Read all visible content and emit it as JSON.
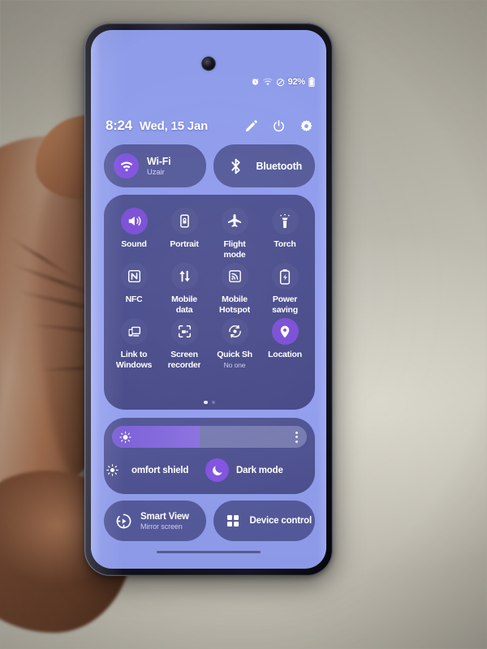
{
  "status_bar": {
    "icons": [
      "alarm-icon",
      "wifi-icon",
      "dnd-icon"
    ],
    "battery_percent": "92%",
    "battery_icon": "battery-icon"
  },
  "header": {
    "time": "8:24",
    "date": "Wed, 15 Jan",
    "actions": [
      {
        "name": "edit-button",
        "icon": "pencil-icon"
      },
      {
        "name": "power-button",
        "icon": "power-icon"
      },
      {
        "name": "settings-button",
        "icon": "gear-icon"
      }
    ]
  },
  "connectivity": [
    {
      "title": "Wi-Fi",
      "subtitle": "Uzair",
      "icon": "wifi-icon",
      "state": "on"
    },
    {
      "title": "Bluetooth",
      "subtitle": "",
      "icon": "bluetooth-icon",
      "state": "off"
    }
  ],
  "tiles": [
    {
      "label": "Sound",
      "sub": "",
      "icon": "speaker-icon",
      "state": "on"
    },
    {
      "label": "Portrait",
      "sub": "",
      "icon": "rotation-lock-icon",
      "state": "off"
    },
    {
      "label": "Flight\nmode",
      "sub": "",
      "icon": "airplane-icon",
      "state": "off"
    },
    {
      "label": "Torch",
      "sub": "",
      "icon": "flashlight-icon",
      "state": "off"
    },
    {
      "label": "NFC",
      "sub": "",
      "icon": "nfc-icon",
      "state": "off"
    },
    {
      "label": "Mobile\ndata",
      "sub": "",
      "icon": "data-arrows-icon",
      "state": "off"
    },
    {
      "label": "Mobile\nHotspot",
      "sub": "",
      "icon": "hotspot-icon",
      "state": "off"
    },
    {
      "label": "Power\nsaving",
      "sub": "",
      "icon": "battery-saver-icon",
      "state": "off"
    },
    {
      "label": "Link to\nWindows",
      "sub": "",
      "icon": "link-windows-icon",
      "state": "off"
    },
    {
      "label": "Screen\nrecorder",
      "sub": "",
      "icon": "screen-record-icon",
      "state": "off"
    },
    {
      "label": "Quick Sh",
      "sub": "No one",
      "icon": "quick-share-icon",
      "state": "off"
    },
    {
      "label": "Location",
      "sub": "",
      "icon": "location-pin-icon",
      "state": "on"
    }
  ],
  "pagination": {
    "total": 2,
    "active": 1
  },
  "brightness": {
    "value_percent": 45,
    "sun_icon": "brightness-sun-icon",
    "menu_icon": "kebab-menu-icon"
  },
  "brightness_toggles": [
    {
      "label": "omfort shield",
      "icon": "eye-comfort-icon",
      "state": "off"
    },
    {
      "label": "Dark mode",
      "icon": "moon-icon",
      "state": "on"
    }
  ],
  "bottom_tiles": [
    {
      "title": "Smart View",
      "subtitle": "Mirror screen",
      "icon": "cast-play-icon"
    },
    {
      "title": "Device control",
      "subtitle": "",
      "icon": "grid-squares-icon"
    }
  ],
  "colors": {
    "screen_bg": "#909dee",
    "panel": "#3e3f7a",
    "accent_purple": "#7b4fd6",
    "accent_purple_light": "#8253e0",
    "text_primary": "#ffffff",
    "text_secondary": "#cfcdee"
  }
}
